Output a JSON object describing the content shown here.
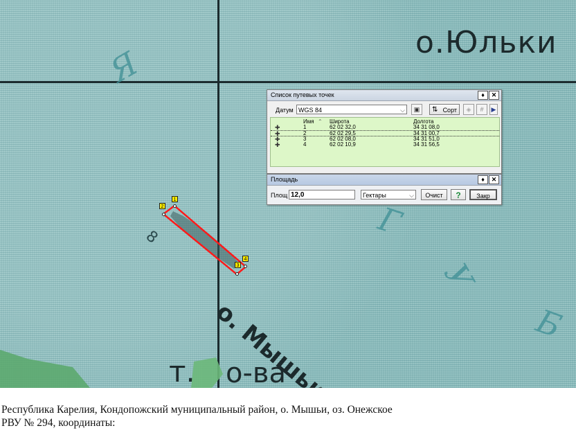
{
  "map": {
    "label_island_top": "о.Юльки",
    "label_island": "о. Мышьи",
    "label_island_number": "8",
    "label_tract": "т.",
    "label_tract_name": "о-ва",
    "lake_letters": [
      "Я",
      "Г",
      "У",
      "Б"
    ]
  },
  "waypoints_window": {
    "title": "Список путевых точек",
    "pin_symbol": "♦",
    "close_symbol": "✕",
    "datum_label": "Датум",
    "datum_value": "WGS 84",
    "sort_label": "Сорт",
    "columns": {
      "name": "Имя",
      "lat": "Широта",
      "lon": "Долгота"
    },
    "rows": [
      {
        "name": "1",
        "lat": "62 02 32,0",
        "lon": "34 31 08,0"
      },
      {
        "name": "2",
        "lat": "62 02 29,5",
        "lon": "34 31 00,7"
      },
      {
        "name": "3",
        "lat": "62 02 08,0",
        "lon": "34 31 51,0"
      },
      {
        "name": "4",
        "lat": "62 02 10,9",
        "lon": "34 31 56,5"
      }
    ]
  },
  "area_window": {
    "title": "Площадь",
    "pin_symbol": "♦",
    "close_symbol": "✕",
    "area_label": "Площ",
    "area_value": "12,0",
    "unit_value": "Гектары",
    "clear_label": "Очист",
    "help_label": "?",
    "close_label": "Закр"
  },
  "polygon_markers": [
    "1",
    "2",
    "3",
    "4"
  ],
  "caption": {
    "line1": "Республика Карелия, Кондопожский муниципальный район, о. Мышьи, оз. Онежское",
    "line2": "РВУ № 294, координаты:"
  }
}
